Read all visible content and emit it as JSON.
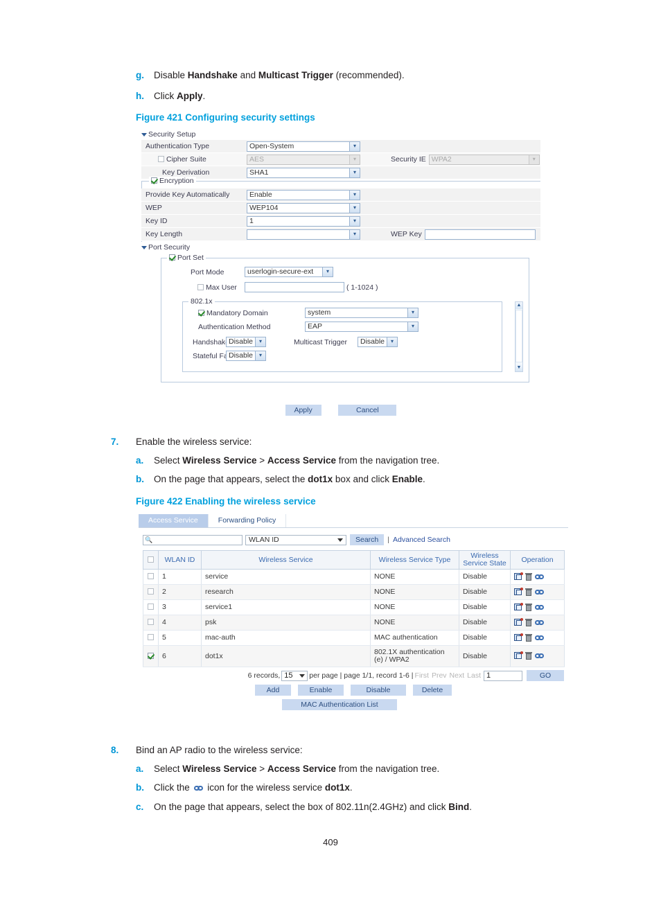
{
  "doc": {
    "step_g": {
      "marker": "g.",
      "text_1": "Disable ",
      "bold_1": "Handshake",
      "text_2": " and ",
      "bold_2": "Multicast Trigger",
      "text_3": " (recommended)."
    },
    "step_h": {
      "marker": "h.",
      "text_1": "Click ",
      "bold_1": "Apply",
      "text_2": "."
    },
    "figure_421_caption": "Figure 421 Configuring security settings",
    "step_7": {
      "marker": "7.",
      "text": "Enable the wireless service:",
      "sub_a": {
        "marker": "a.",
        "text_1": "Select ",
        "bold_1": "Wireless Service",
        "text_2": " > ",
        "bold_2": "Access Service",
        "text_3": " from the navigation tree."
      },
      "sub_b": {
        "marker": "b.",
        "text_1": "On the page that appears, select the ",
        "bold_1": "dot1x",
        "text_2": " box and click ",
        "bold_2": "Enable",
        "text_3": "."
      }
    },
    "figure_422_caption": "Figure 422 Enabling the wireless service",
    "step_8": {
      "marker": "8.",
      "text": "Bind an AP radio to the wireless service:",
      "sub_a": {
        "marker": "a.",
        "text_1": "Select ",
        "bold_1": "Wireless Service",
        "text_2": " > ",
        "bold_2": "Access Service",
        "text_3": " from the navigation tree."
      },
      "sub_b": {
        "marker": "b.",
        "text_1": "Click the ",
        "text_2": " icon for the wireless service ",
        "bold_1": "dot1x",
        "text_3": "."
      },
      "sub_c": {
        "marker": "c.",
        "text_1": "On the page that appears, select the box of 802.11n(2.4GHz) and click ",
        "bold_1": "Bind",
        "text_2": "."
      }
    },
    "page_number": "409",
    "accent_color": "#00a0dd"
  },
  "figure_421": {
    "security_setup": {
      "section_title": "Security Setup",
      "rows": [
        {
          "label": "Authentication Type",
          "value": "Open-System",
          "disabled": false
        },
        {
          "label": "Cipher Suite",
          "value": "AES",
          "disabled": true
        },
        {
          "label": "Key Derivation",
          "value": "SHA1",
          "disabled": false
        }
      ],
      "security_ie": {
        "label": "Security IE",
        "value": "WPA2",
        "disabled": true
      }
    },
    "encryption": {
      "legend": "Encryption",
      "checked": true,
      "rows": [
        {
          "label": "Provide Key Automatically",
          "value": "Enable"
        },
        {
          "label": "WEP",
          "value": "WEP104"
        },
        {
          "label": "Key ID",
          "value": "1"
        },
        {
          "label": "Key Length",
          "value": ""
        }
      ],
      "wep_key": {
        "label": "WEP Key",
        "value": ""
      }
    },
    "port_security": {
      "section_title": "Port Security",
      "port_set": {
        "legend": "Port Set",
        "checked": true,
        "port_mode": {
          "label": "Port Mode",
          "value": "userlogin-secure-ext"
        },
        "max_user": {
          "label": "Max User",
          "value": "",
          "hint": "( 1-1024 )",
          "checked": false
        }
      },
      "dot1x": {
        "legend": "802.1x",
        "mandatory_domain": {
          "label": "Mandatory Domain",
          "checked": true,
          "value": "system"
        },
        "auth_method": {
          "label": "Authentication Method",
          "value": "EAP"
        },
        "handshake": {
          "label": "Handshake",
          "value": "Disable"
        },
        "multicast_trigger": {
          "label": "Multicast Trigger",
          "value": "Disable"
        },
        "stateful_failover": {
          "label": "Stateful Failover",
          "value": "Disable"
        }
      }
    },
    "buttons": {
      "apply": "Apply",
      "cancel": "Cancel"
    }
  },
  "figure_422": {
    "tabs": [
      {
        "label": "Access Service",
        "active": true
      },
      {
        "label": "Forwarding Policy",
        "active": false
      }
    ],
    "search": {
      "input_value": "",
      "field_selected": "WLAN ID",
      "search_button": "Search",
      "separator": "|",
      "advanced_link": "Advanced Search"
    },
    "table": {
      "headers": [
        "",
        "WLAN ID",
        "Wireless Service",
        "Wireless Service Type",
        "Wireless Service State",
        "Operation"
      ],
      "rows": [
        {
          "checked": false,
          "wlan_id": "1",
          "service": "service",
          "type": "NONE",
          "state": "Disable"
        },
        {
          "checked": false,
          "wlan_id": "2",
          "service": "research",
          "type": "NONE",
          "state": "Disable"
        },
        {
          "checked": false,
          "wlan_id": "3",
          "service": "service1",
          "type": "NONE",
          "state": "Disable"
        },
        {
          "checked": false,
          "wlan_id": "4",
          "service": "psk",
          "type": "NONE",
          "state": "Disable"
        },
        {
          "checked": false,
          "wlan_id": "5",
          "service": "mac-auth",
          "type": "MAC authentication",
          "state": "Disable"
        },
        {
          "checked": true,
          "wlan_id": "6",
          "service": "dot1x",
          "type": "802.1X authentication (e) / WPA2",
          "state": "Disable"
        }
      ]
    },
    "pager": {
      "records_text": "6 records,",
      "per_page_value": "15",
      "per_page_text": "per page | page 1/1, record 1-6 |",
      "first": "First",
      "prev": "Prev",
      "next": "Next",
      "last": "Last",
      "page_input": "1",
      "go": "GO"
    },
    "buttons": {
      "add": "Add",
      "enable": "Enable",
      "disable": "Disable",
      "delete": "Delete",
      "mac_auth_list": "MAC Authentication List"
    }
  }
}
